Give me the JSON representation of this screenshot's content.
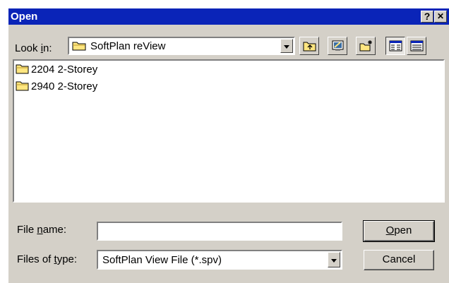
{
  "dialog": {
    "title": "Open",
    "help_button": "?",
    "close_button": "✕"
  },
  "lookin": {
    "label_pre": "Look ",
    "label_mnemonic": "i",
    "label_post": "n:",
    "value": "SoftPlan reView"
  },
  "toolbar": {
    "icons": [
      "up-one-level-icon",
      "desktop-icon",
      "new-folder-icon",
      "list-view-icon",
      "details-view-icon"
    ]
  },
  "files": [
    {
      "name": "2204 2-Storey",
      "icon": "folder-icon"
    },
    {
      "name": "2940 2-Storey",
      "icon": "folder-icon"
    }
  ],
  "filename": {
    "label_pre": "File ",
    "label_mnemonic": "n",
    "label_post": "ame:",
    "value": ""
  },
  "filetype": {
    "label_pre": "Files of ",
    "label_mnemonic": "t",
    "label_post": "ype:",
    "value": "SoftPlan View File (*.spv)"
  },
  "buttons": {
    "open_mnemonic": "O",
    "open_rest": "pen",
    "cancel": "Cancel"
  },
  "colors": {
    "titlebar": "#0a24b8",
    "face": "#d4d0c8",
    "folder": "#ffe680"
  }
}
